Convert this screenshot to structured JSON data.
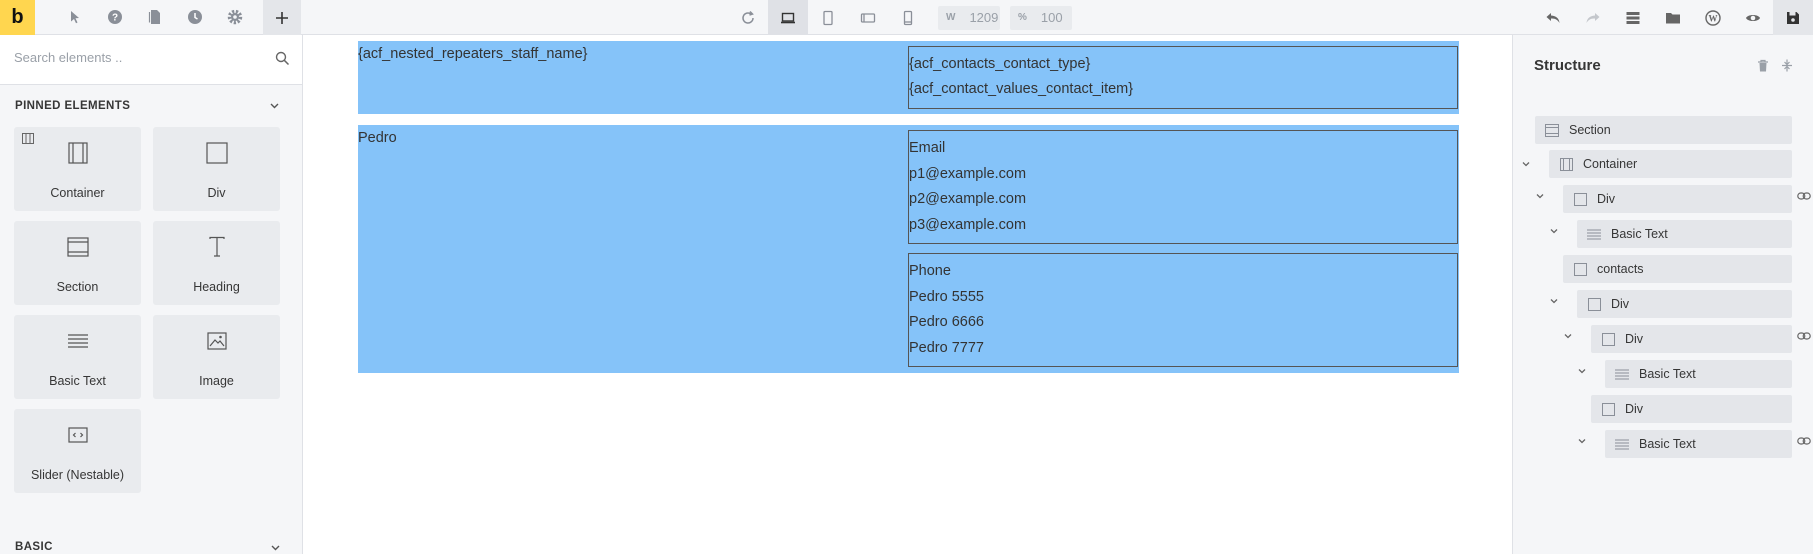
{
  "toolbar": {
    "logo": "b",
    "width_label": "W",
    "width_value": "1209",
    "zoom_label": "%",
    "zoom_value": "100"
  },
  "elements_panel": {
    "search_placeholder": "Search elements ..",
    "pinned_title": "PINNED ELEMENTS",
    "pinned": [
      {
        "label": "Container",
        "icon": "container-icon"
      },
      {
        "label": "Div",
        "icon": "div-icon"
      },
      {
        "label": "Section",
        "icon": "section-icon"
      },
      {
        "label": "Heading",
        "icon": "heading-icon"
      },
      {
        "label": "Basic Text",
        "icon": "basic-text-icon"
      },
      {
        "label": "Image",
        "icon": "image-icon"
      },
      {
        "label": "Slider (Nestable)",
        "icon": "slider-icon"
      }
    ],
    "basic_title": "BASIC"
  },
  "canvas": {
    "row1": {
      "name": "{acf_nested_repeaters_staff_name}",
      "contact_lines": [
        "{acf_contacts_contact_type}",
        "{acf_contact_values_contact_item}"
      ]
    },
    "row2": {
      "name": "Pedro",
      "email_lines": [
        "Email",
        "p1@example.com",
        "p2@example.com",
        "p3@example.com"
      ],
      "phone_lines": [
        "Phone",
        "Pedro 5555",
        "Pedro 6666",
        "Pedro 7777"
      ]
    },
    "highlight_color": "#85c3f9"
  },
  "structure": {
    "title": "Structure",
    "nodes": [
      {
        "label": "Section"
      },
      {
        "label": "Container"
      },
      {
        "label": "Div"
      },
      {
        "label": "Basic Text"
      },
      {
        "label": "contacts"
      },
      {
        "label": "Div"
      },
      {
        "label": "Div"
      },
      {
        "label": "Basic Text"
      },
      {
        "label": "Div"
      },
      {
        "label": "Basic Text"
      }
    ]
  },
  "colors": {
    "accent": "#ffd64f",
    "panel_bg": "#f5f6f8"
  }
}
